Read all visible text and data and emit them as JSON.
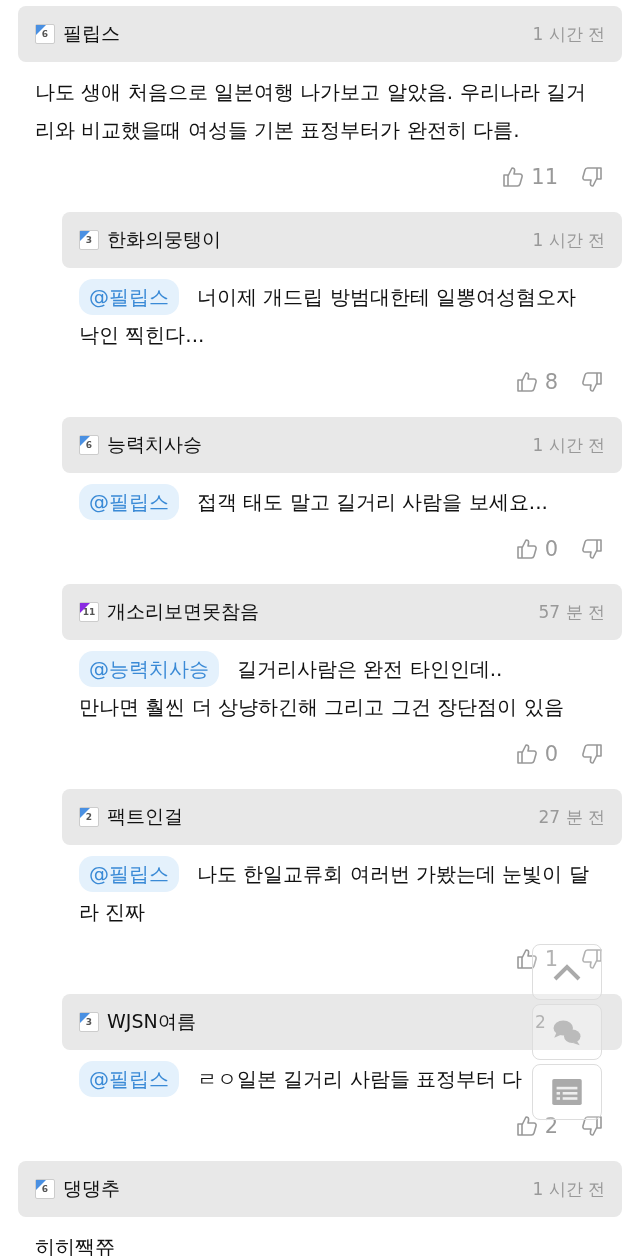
{
  "comments": [
    {
      "user": "필립스",
      "badge": {
        "level": "6",
        "color": "#4a90e2"
      },
      "time": "1 시간 전",
      "text": "나도 생애 처음으로 일본여행 나가보고 알았음. 우리나라 길거리와 비교했을때 여성들 기본 표정부터가 완전히 다름.",
      "likes": "11",
      "children": [
        {
          "user": "한화의뭉탱이",
          "badge": {
            "level": "3",
            "color": "#4a90e2"
          },
          "time": "1 시간 전",
          "mention": "@필립스",
          "text": "너이제 개드립 방범대한테 일뽕여성혐오자 낙인 찍힌다...",
          "likes": "8"
        },
        {
          "user": "능력치사승",
          "badge": {
            "level": "6",
            "color": "#4a90e2"
          },
          "time": "1 시간 전",
          "mention": "@필립스",
          "text": "접객 태도 말고 길거리 사람을 보세요...",
          "likes": "0"
        },
        {
          "user": "개소리보면못참음",
          "badge": {
            "level": "11",
            "color": "#8a2be2"
          },
          "time": "57 분 전",
          "mention": "@능력치사승",
          "text": "길거리사람은 완전 타인인데..\n만나면 훨씬 더 상냥하긴해 그리고 그건 장단점이 있음",
          "likes": "0"
        },
        {
          "user": "팩트인걸",
          "badge": {
            "level": "2",
            "color": "#4a90e2"
          },
          "time": "27 분 전",
          "mention": "@필립스",
          "text": "나도 한일교류회 여러번 가봤는데 눈빛이 달라 진짜",
          "likes": "1"
        },
        {
          "user": "WJSN여름",
          "badge": {
            "level": "3",
            "color": "#4a90e2"
          },
          "time_parts": [
            "2"
          ],
          "mention": "@필립스",
          "text": "ㄹㅇ일본 길거리 사람들 표정부터 다",
          "likes": "2"
        }
      ]
    },
    {
      "user": "댕댕추",
      "badge": {
        "level": "6",
        "color": "#4a90e2"
      },
      "time": "1 시간 전",
      "text": "히히짹쮸"
    }
  ]
}
